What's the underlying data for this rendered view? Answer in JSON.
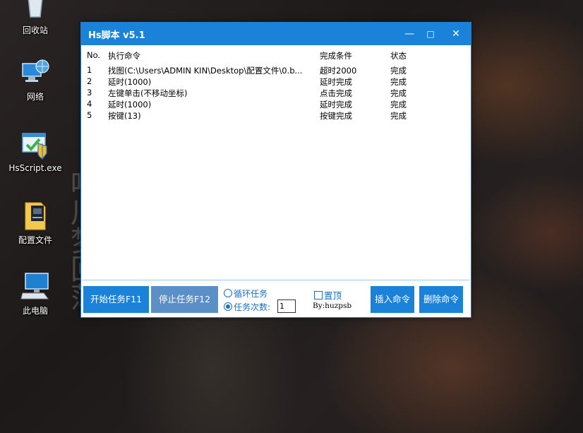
{
  "desktop": {
    "icons": [
      {
        "label": "回收站",
        "icon": "recycle-bin-icon"
      },
      {
        "label": "网络",
        "icon": "network-icon"
      },
      {
        "label": "HsScript.exe",
        "icon": "application-icon"
      },
      {
        "label": "配置文件",
        "icon": "folder-icon"
      },
      {
        "label": "此电脑",
        "icon": "computer-icon"
      }
    ],
    "calligraphy": [
      "吵",
      "川",
      "梦",
      "回",
      "荡"
    ]
  },
  "window": {
    "title": "Hs脚本 v5.1",
    "controls": {
      "minimize": "—",
      "maximize": "□",
      "close": "✕"
    },
    "columns": {
      "no": "No.",
      "command": "执行命令",
      "condition": "完成条件",
      "status": "状态"
    },
    "rows": [
      {
        "no": "1",
        "command": "找图(C:\\Users\\ADMIN KIN\\Desktop\\配置文件\\0.b...",
        "condition": "超时2000",
        "status": "完成"
      },
      {
        "no": "2",
        "command": "延时(1000)",
        "condition": "延时完成",
        "status": "完成"
      },
      {
        "no": "3",
        "command": "左键单击(不移动坐标)",
        "condition": "点击完成",
        "status": "完成"
      },
      {
        "no": "4",
        "command": "延时(1000)",
        "condition": "延时完成",
        "status": "完成"
      },
      {
        "no": "5",
        "command": "按键(13)",
        "condition": "按键完成",
        "status": "完成"
      }
    ],
    "bottom": {
      "start_label": "开始任务F11",
      "stop_label": "停止任务F12",
      "loop_label": "循环任务",
      "count_label": "任务次数:",
      "count_value": "1",
      "pin_label": "置顶",
      "author": "By:huzpsb",
      "insert_label": "插入命令",
      "delete_label": "删除命令"
    },
    "colors": {
      "accent": "#1a82d8",
      "stop_button": "#5b8fc7",
      "radio_text": "#1a6fc0"
    }
  }
}
